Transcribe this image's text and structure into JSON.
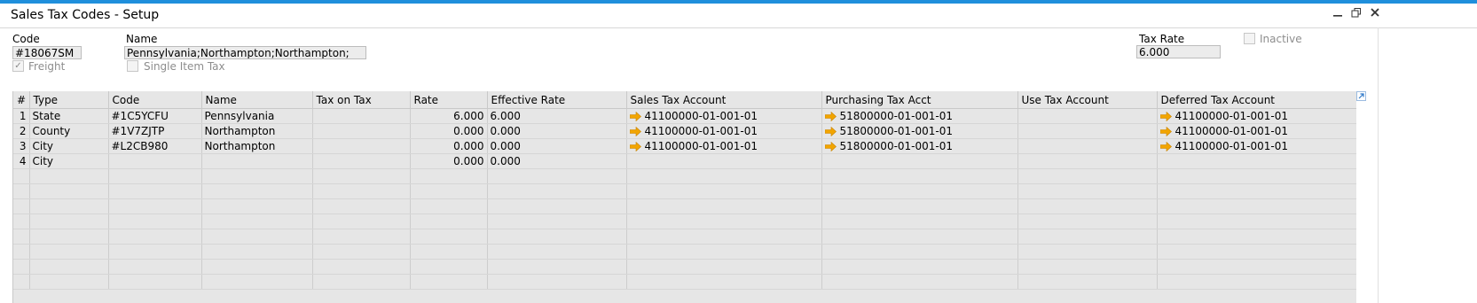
{
  "window": {
    "title": "Sales Tax Codes - Setup",
    "minimize_icon": "minimize-icon",
    "restore_icon": "restore-icon",
    "close_icon": "close-icon"
  },
  "header": {
    "code_label": "Code",
    "code_value": "#18067SM",
    "name_label": "Name",
    "name_value": "Pennsylvania;Northampton;Northampton;",
    "tax_rate_label": "Tax Rate",
    "tax_rate_value": "6.000",
    "inactive_label": "Inactive",
    "inactive_checked": false,
    "freight_label": "Freight",
    "freight_checked": true,
    "single_item_tax_label": "Single Item Tax",
    "single_item_tax_checked": false
  },
  "grid": {
    "columns": [
      "#",
      "Type",
      "Code",
      "Name",
      "Tax on Tax",
      "Rate",
      "Effective Rate",
      "Sales Tax Account",
      "Purchasing Tax Acct",
      "Use Tax Account",
      "Deferred Tax Account"
    ],
    "rows": [
      {
        "num": "1",
        "type": "State",
        "code": "#1C5YCFU",
        "name": "Pennsylvania",
        "tax_on_tax": "",
        "rate": "6.000",
        "effective_rate": "6.000",
        "sales_tax_account": "41100000-01-001-01",
        "purchasing_tax_acct": "51800000-01-001-01",
        "use_tax_account": "",
        "deferred_tax_account": "41100000-01-001-01"
      },
      {
        "num": "2",
        "type": "County",
        "code": "#1V7ZJTP",
        "name": "Northampton",
        "tax_on_tax": "",
        "rate": "0.000",
        "effective_rate": "0.000",
        "sales_tax_account": "41100000-01-001-01",
        "purchasing_tax_acct": "51800000-01-001-01",
        "use_tax_account": "",
        "deferred_tax_account": "41100000-01-001-01"
      },
      {
        "num": "3",
        "type": "City",
        "code": "#L2CB980",
        "name": "Northampton",
        "tax_on_tax": "",
        "rate": "0.000",
        "effective_rate": "0.000",
        "sales_tax_account": "41100000-01-001-01",
        "purchasing_tax_acct": "51800000-01-001-01",
        "use_tax_account": "",
        "deferred_tax_account": "41100000-01-001-01"
      },
      {
        "num": "4",
        "type": "City",
        "code": "",
        "name": "",
        "tax_on_tax": "",
        "rate": "0.000",
        "effective_rate": "0.000",
        "sales_tax_account": "",
        "purchasing_tax_acct": "",
        "use_tax_account": "",
        "deferred_tax_account": ""
      }
    ],
    "empty_rows": 8,
    "link_arrow_color": "#f2a500",
    "expand_icon": "expand-arrow-icon"
  },
  "colors": {
    "accent": "#1f8fdc",
    "grid_bg": "#e6e6e6",
    "field_bg": "#ececec"
  }
}
